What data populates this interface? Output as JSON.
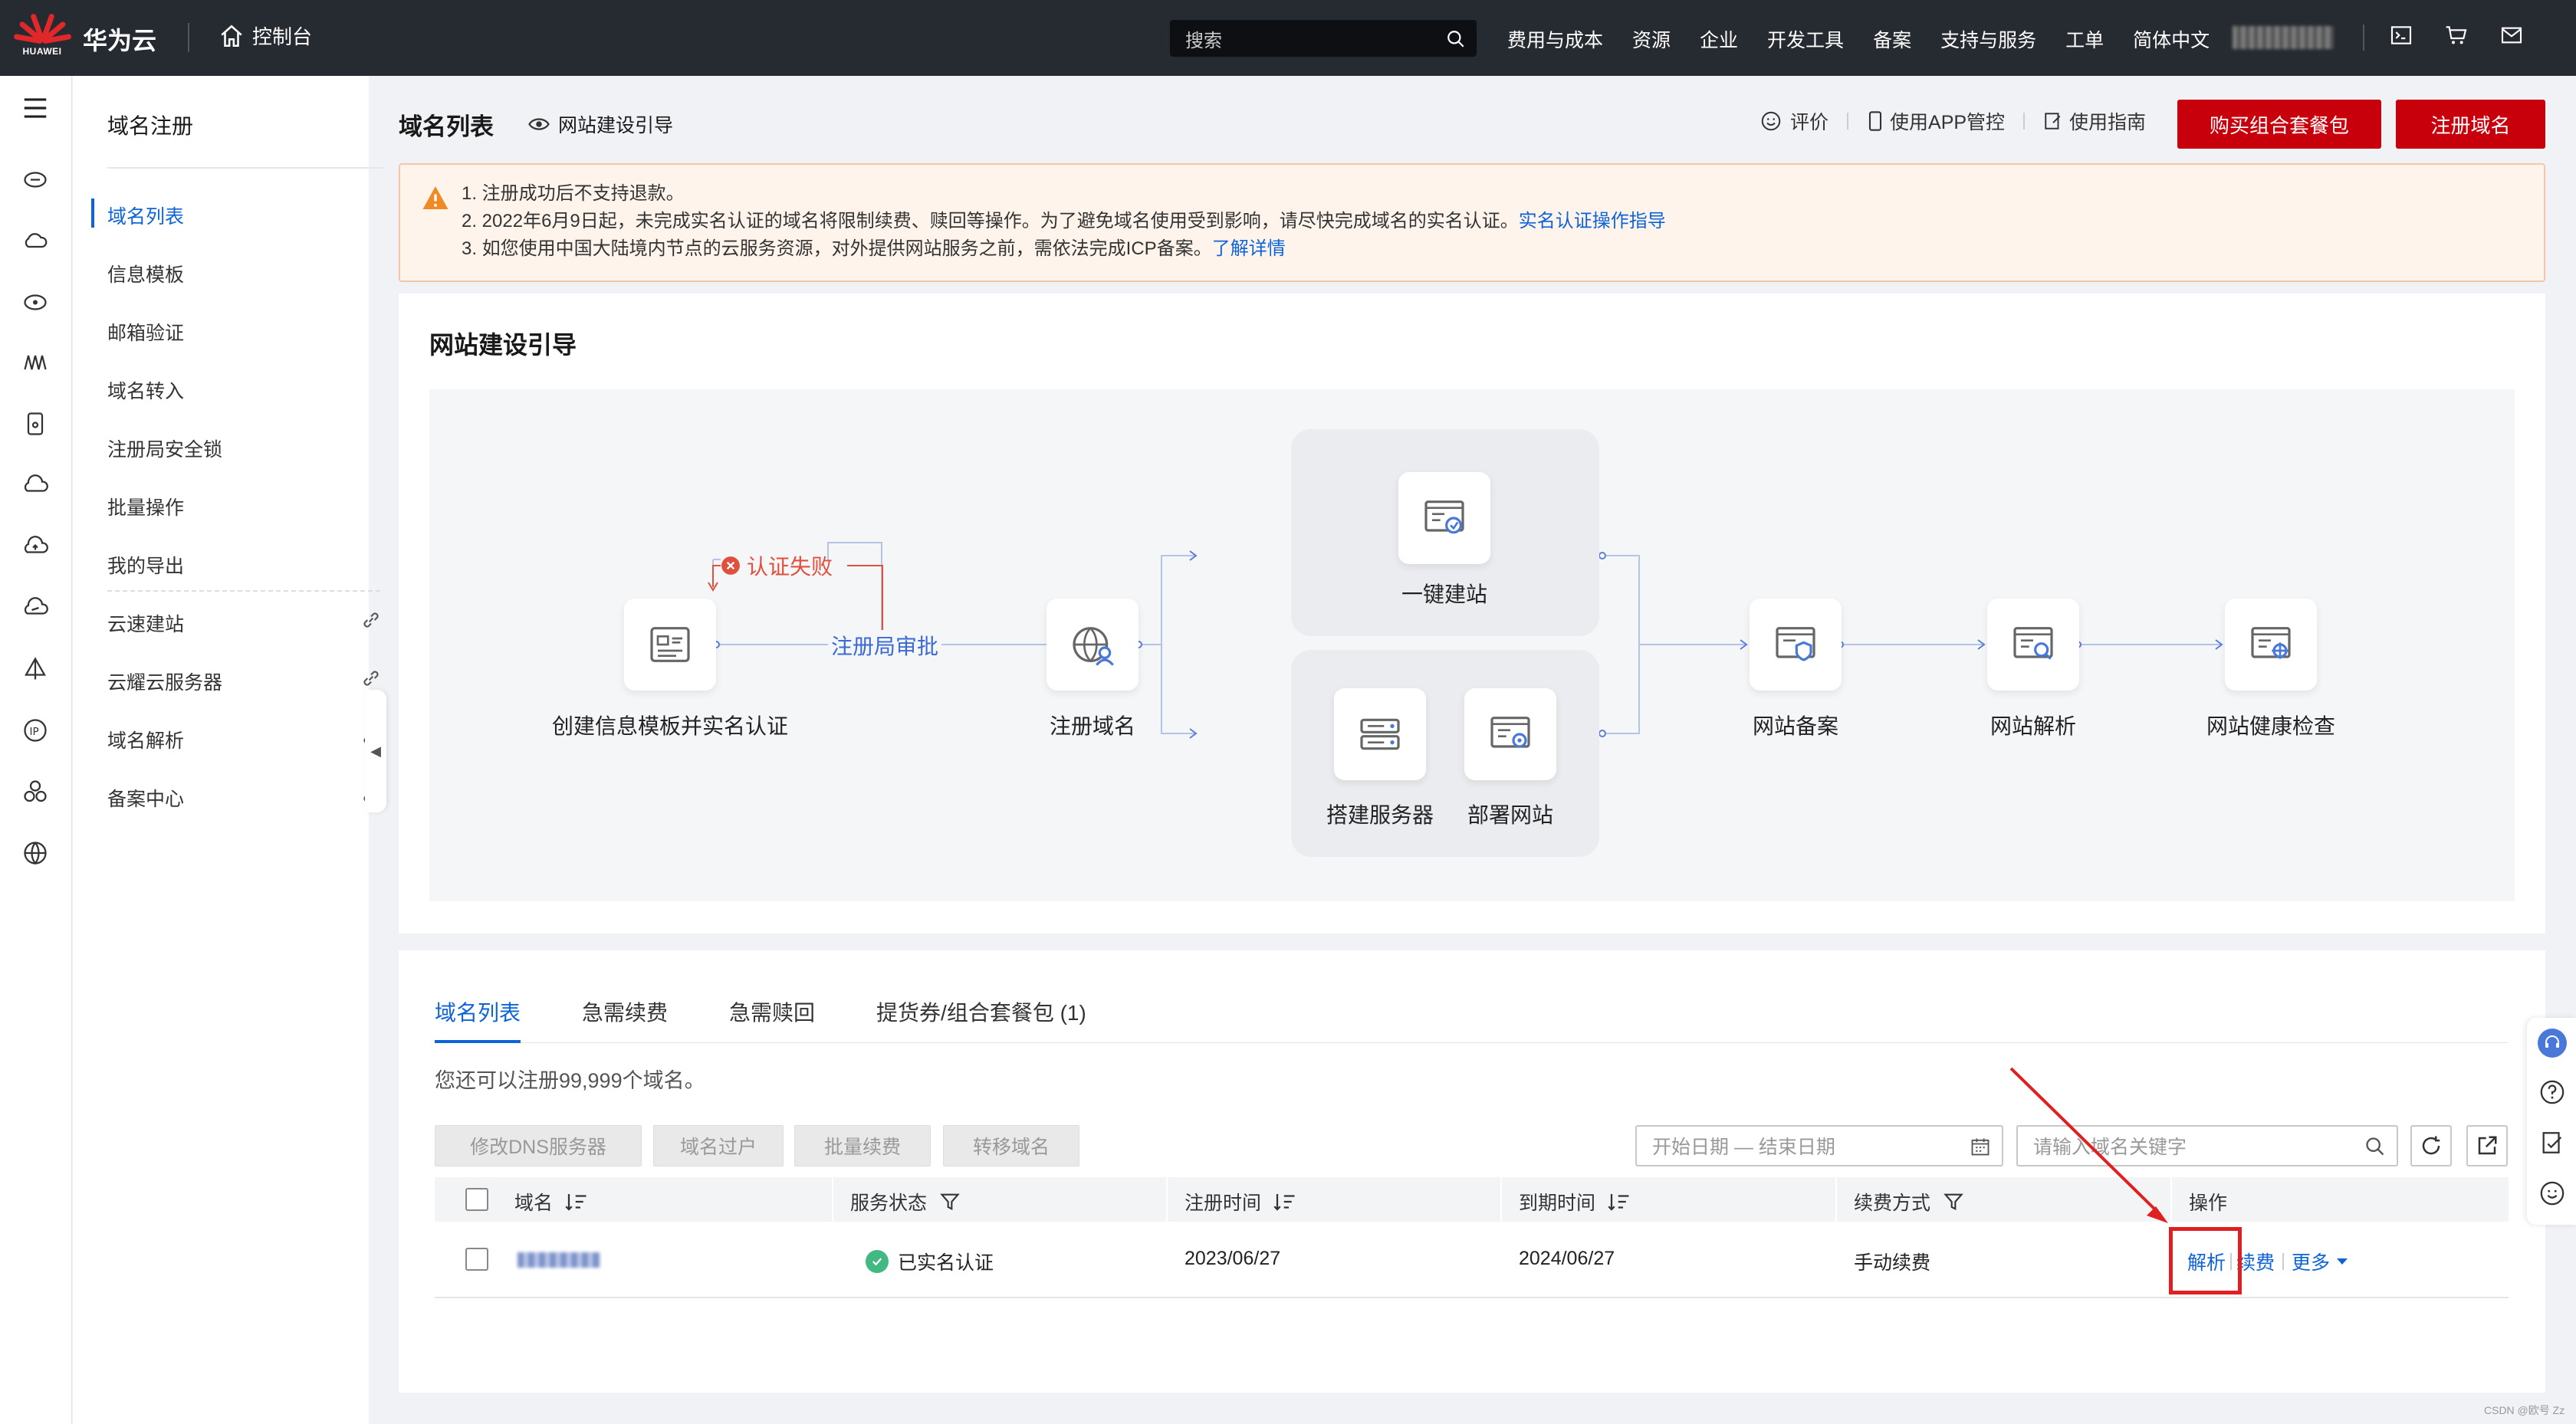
{
  "topbar": {
    "logo_text": "HUAWEI",
    "brand": "华为云",
    "console": "控制台",
    "search_placeholder": "搜索",
    "nav": [
      "费用与成本",
      "资源",
      "企业",
      "开发工具",
      "备案",
      "支持与服务",
      "工单",
      "简体中文"
    ],
    "icons": [
      "terminal-icon",
      "cart-icon",
      "mail-icon"
    ]
  },
  "sidenav": {
    "title": "域名注册",
    "items": [
      "域名列表",
      "信息模板",
      "邮箱验证",
      "域名转入",
      "注册局安全锁",
      "批量操作",
      "我的导出"
    ],
    "link_items": [
      "云速建站",
      "云耀云服务器",
      "域名解析",
      "备案中心"
    ]
  },
  "header": {
    "title": "域名列表",
    "guide": "网站建设引导",
    "rate": "评价",
    "app": "使用APP管控",
    "manual": "使用指南",
    "buy_btn": "购买组合套餐包",
    "register_btn": "注册域名"
  },
  "notice": {
    "line1": "1. 注册成功后不支持退款。",
    "line2": "2. 2022年6月9日起，未完成实名认证的域名将限制续费、赎回等操作。为了避免域名使用受到影响，请尽快完成域名的实名认证。",
    "line2_link": "实名认证操作指导",
    "line3": "3. 如您使用中国大陆境内节点的云服务资源，对外提供网站服务之前，需依法完成ICP备案。",
    "line3_link": "了解详情"
  },
  "guide_card": {
    "title": "网站建设引导",
    "fail": "认证失败",
    "approve": "注册局审批",
    "steps": {
      "template": "创建信息模板并实名认证",
      "register": "注册域名",
      "onekey": "一键建站",
      "server": "搭建服务器",
      "deploy": "部署网站",
      "beian": "网站备案",
      "resolve": "网站解析",
      "health": "网站健康检查"
    }
  },
  "list_card": {
    "tabs": [
      "域名列表",
      "急需续费",
      "急需赎回",
      "提货券/组合套餐包 (1)"
    ],
    "remaining": "您还可以注册99,999个域名。",
    "batch_buttons": [
      "修改DNS服务器",
      "域名过户",
      "批量续费",
      "转移域名"
    ],
    "date_placeholder": "开始日期 — 结束日期",
    "keyword_placeholder": "请输入域名关键字",
    "columns": [
      "域名",
      "服务状态",
      "注册时间",
      "到期时间",
      "续费方式",
      "操作"
    ],
    "rows": [
      {
        "status": "已实名认证",
        "reg": "2023/06/27",
        "exp": "2024/06/27",
        "renew": "手动续费",
        "actions": [
          "解析",
          "续费",
          "更多"
        ]
      }
    ]
  },
  "watermark": "CSDN @欧号 Zz",
  "colors": {
    "brand_red": "#c7000b",
    "link": "#0d63d8",
    "highlight": "#e02020"
  }
}
